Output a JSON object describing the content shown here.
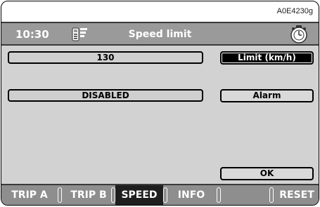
{
  "ref_code": "A0E4230g",
  "header": {
    "time": "10:30",
    "title": "Speed limit",
    "left_icon": "phone-icon",
    "right_icon": "clock-icon"
  },
  "fields": {
    "limit_value": "130",
    "alarm_status": "DISABLED"
  },
  "buttons": {
    "limit": "Limit (km/h)",
    "alarm": "Alarm",
    "ok": "OK"
  },
  "tabs": [
    {
      "label": "TRIP A"
    },
    {
      "label": "TRIP B"
    },
    {
      "label": "SPEED"
    },
    {
      "label": "INFO"
    },
    {
      "label": ""
    },
    {
      "label": "RESET"
    }
  ],
  "selected_tab": "SPEED"
}
